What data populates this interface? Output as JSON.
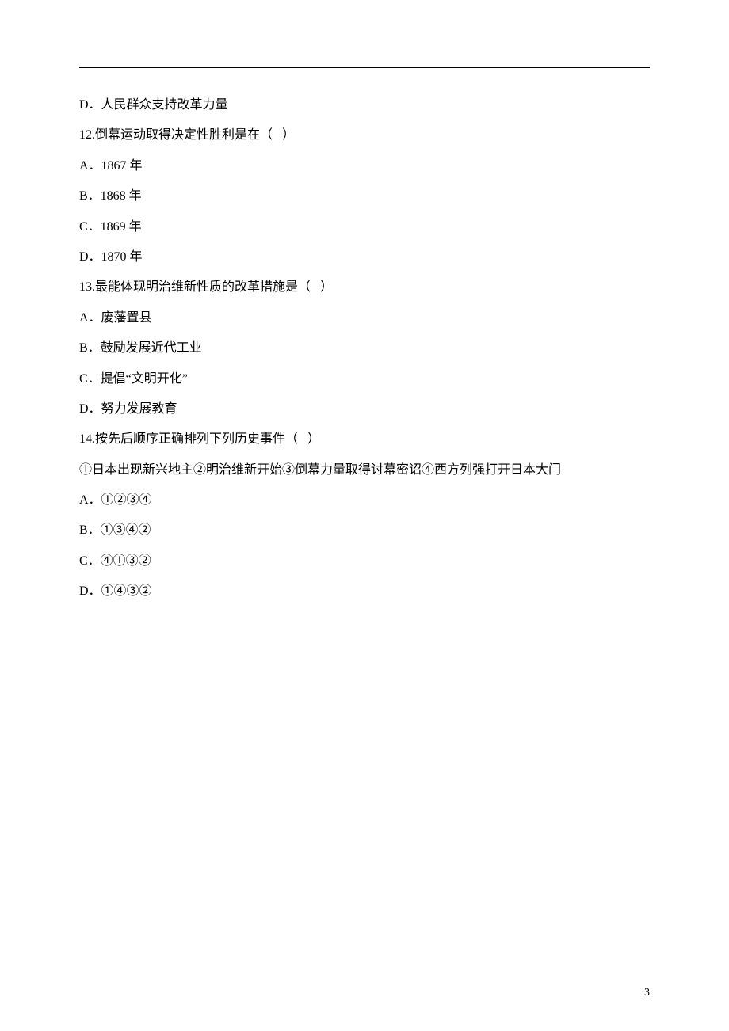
{
  "page_number": "3",
  "lines": [
    "D．人民群众支持改革力量",
    "12.倒幕运动取得决定性胜利是在（   ）",
    "A．1867 年",
    "B．1868 年",
    "C．1869 年",
    "D．1870 年",
    "13.最能体现明治维新性质的改革措施是（   ）",
    "A．废藩置县",
    "B．鼓励发展近代工业",
    "C．提倡“文明开化”",
    "D．努力发展教育",
    "14.按先后顺序正确排列下列历史事件（   ）",
    "①日本出现新兴地主②明治维新开始③倒幕力量取得讨幕密诏④西方列强打开日本大门",
    "A．①②③④",
    "B．①③④②",
    "C．④①③②",
    "D．①④③②"
  ]
}
